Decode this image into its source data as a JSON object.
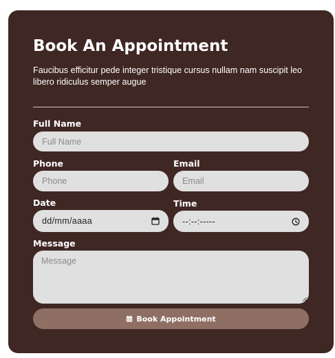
{
  "form": {
    "title": "Book An Appointment",
    "subtitle": "Faucibus efficitur pede integer tristique cursus nullam nam suscipit leo libero ridiculus semper augue",
    "full_name": {
      "label": "Full Name",
      "placeholder": "Full Name",
      "value": ""
    },
    "phone": {
      "label": "Phone",
      "placeholder": "Phone",
      "value": ""
    },
    "email": {
      "label": "Email",
      "placeholder": "Email",
      "value": ""
    },
    "date": {
      "label": "Date",
      "value": "dd/mm/aaaa",
      "icon": "calendar-icon"
    },
    "time": {
      "label": "Time",
      "value": "--:--:-----",
      "icon": "clock-icon"
    },
    "message": {
      "label": "Message",
      "placeholder": "Message",
      "value": ""
    },
    "submit": {
      "label": "Book Appointment",
      "icon": "calendar-icon"
    }
  },
  "colors": {
    "card_background": "#3f2723",
    "input_background": "#e0e0e0",
    "button_background": "#8f6f64",
    "text": "#ffffff"
  }
}
